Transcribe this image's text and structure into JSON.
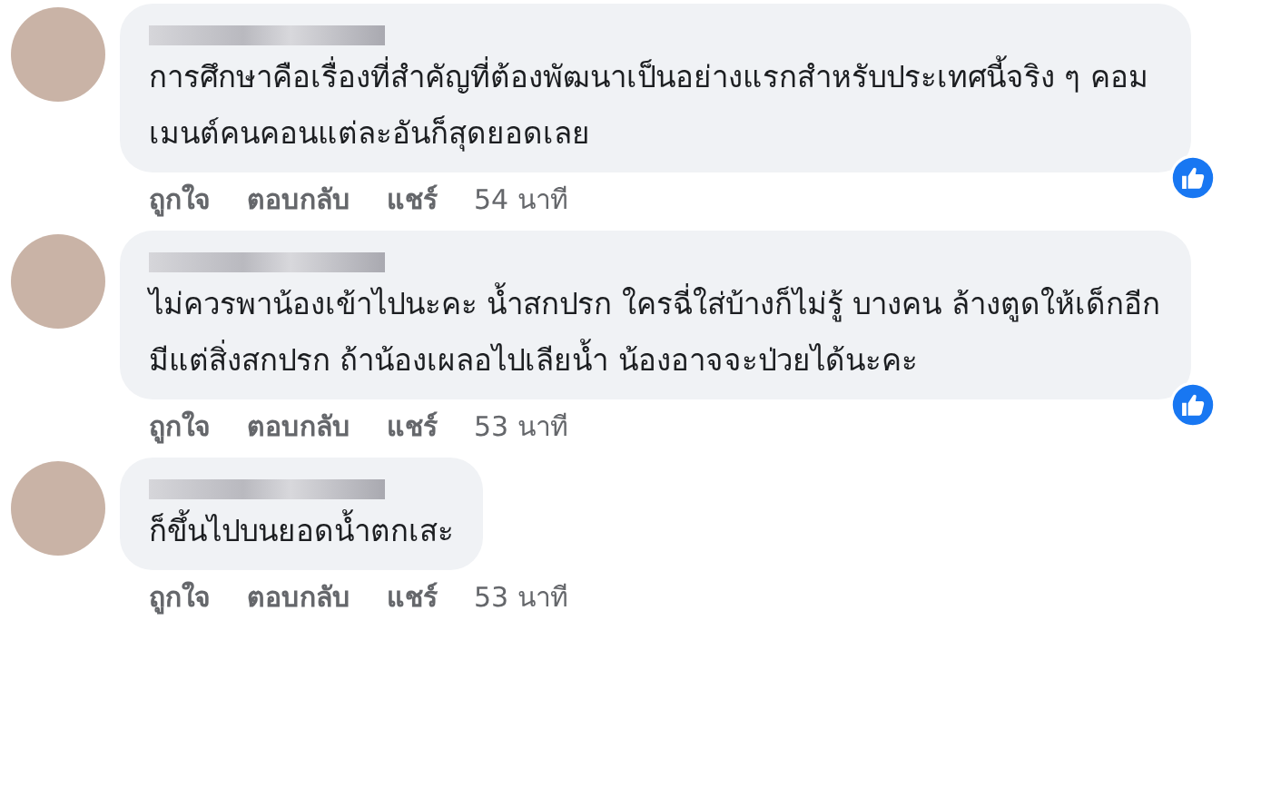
{
  "comments": [
    {
      "text": "การศึกษาคือเรื่องที่สำคัญที่ต้องพัฒนาเป็นอย่างแรกสำหรับประเทศนี้จริง ๆ คอมเมนต์คนคอนแต่ละอันก็สุดยอดเลย",
      "actions": [
        "ถูกใจ",
        "ตอบกลับ",
        "แชร์"
      ],
      "time": "54 นาที",
      "liked": true
    },
    {
      "text": "ไม่ควรพาน้องเข้าไปนะคะ น้ำสกปรก ใครฉี่ใส่บ้างก็ไม่รู้ บางคน ล้างตูดให้เด็กอีก มีแต่สิ่งสกปรก ถ้าน้องเผลอไปเลียน้ำ น้องอาจจะป่วยได้นะคะ",
      "actions": [
        "ถูกใจ",
        "ตอบกลับ",
        "แชร์"
      ],
      "time": "53 นาที",
      "liked": true
    },
    {
      "text": "ก็ขึ้นไปบนยอดน้ำตกเสะ",
      "actions": [
        "ถูกใจ",
        "ตอบกลับ",
        "แชร์"
      ],
      "time": "53 นาที",
      "liked": false
    }
  ]
}
